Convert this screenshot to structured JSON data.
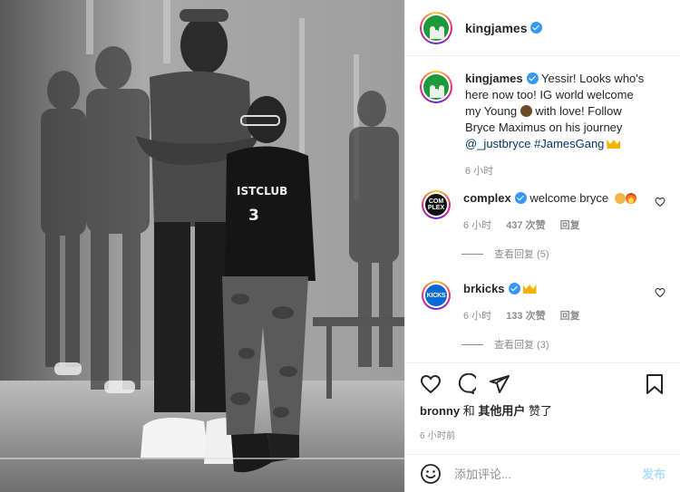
{
  "post": {
    "username": "kingjames",
    "caption": {
      "username": "kingjames",
      "text_before": "Yessir! Looks who's here now too! IG world welcome my Young",
      "text_middle": "with love! Follow Bryce Maximus on his journey",
      "mention": "@_justbryce",
      "hashtag": "#JamesGang",
      "time": "6 小时"
    },
    "photo": {
      "jersey_text": "ISTCLUB",
      "jersey_number": "3"
    }
  },
  "comments": [
    {
      "username": "complex",
      "avatar_text_1": "COM",
      "avatar_text_2": "PLEX",
      "text": "welcome bryce",
      "time": "6 小时",
      "likes": "437 次赞",
      "reply": "回复",
      "view_replies": "查看回复 (5)"
    },
    {
      "username": "brkicks",
      "avatar_text": "KICKS",
      "text": "",
      "time": "6 小时",
      "likes": "133 次赞",
      "reply": "回复",
      "view_replies": "查看回复 (3)"
    }
  ],
  "likes_line": {
    "user": "bronny",
    "conj": "和",
    "others": "其他用户",
    "suffix": "赞了"
  },
  "post_time": "6 小时前",
  "add_comment": {
    "placeholder": "添加评论...",
    "post_label": "发布"
  },
  "icons": [
    "heart-icon",
    "comment-icon",
    "share-icon",
    "bookmark-icon",
    "emoji-icon",
    "verified-badge-icon",
    "crown-emoji-icon"
  ],
  "colors": {
    "link": "#00376b",
    "verified": "#3897f0",
    "muted": "#8e8e8e",
    "post_button": "#b2dffc"
  }
}
